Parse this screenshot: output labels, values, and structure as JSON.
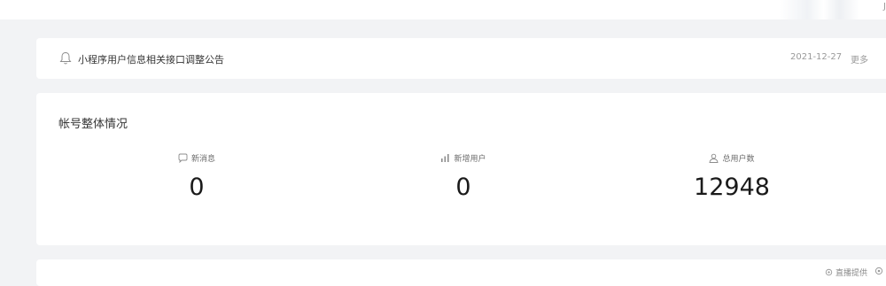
{
  "topbar": {
    "corner_mark": "J"
  },
  "notice": {
    "icon": "bell-icon",
    "text": "小程序用户信息相关接口调整公告",
    "date": "2021-12-27",
    "more_label": "更多"
  },
  "stats": {
    "title": "帐号整体情况",
    "items": [
      {
        "icon": "message-icon",
        "label": "新消息",
        "value": "0"
      },
      {
        "icon": "bar-chart-icon",
        "label": "新增用户",
        "value": "0"
      },
      {
        "icon": "user-icon",
        "label": "总用户数",
        "value": "12948"
      }
    ]
  },
  "bottom": {
    "link_icon": "settings-icon",
    "link_label": "直播提供",
    "second_icon": "settings-icon"
  },
  "colors": {
    "page_bg": "#f2f3f5",
    "card_bg": "#ffffff",
    "text_primary": "#353535",
    "text_muted": "#9a9a9a"
  }
}
